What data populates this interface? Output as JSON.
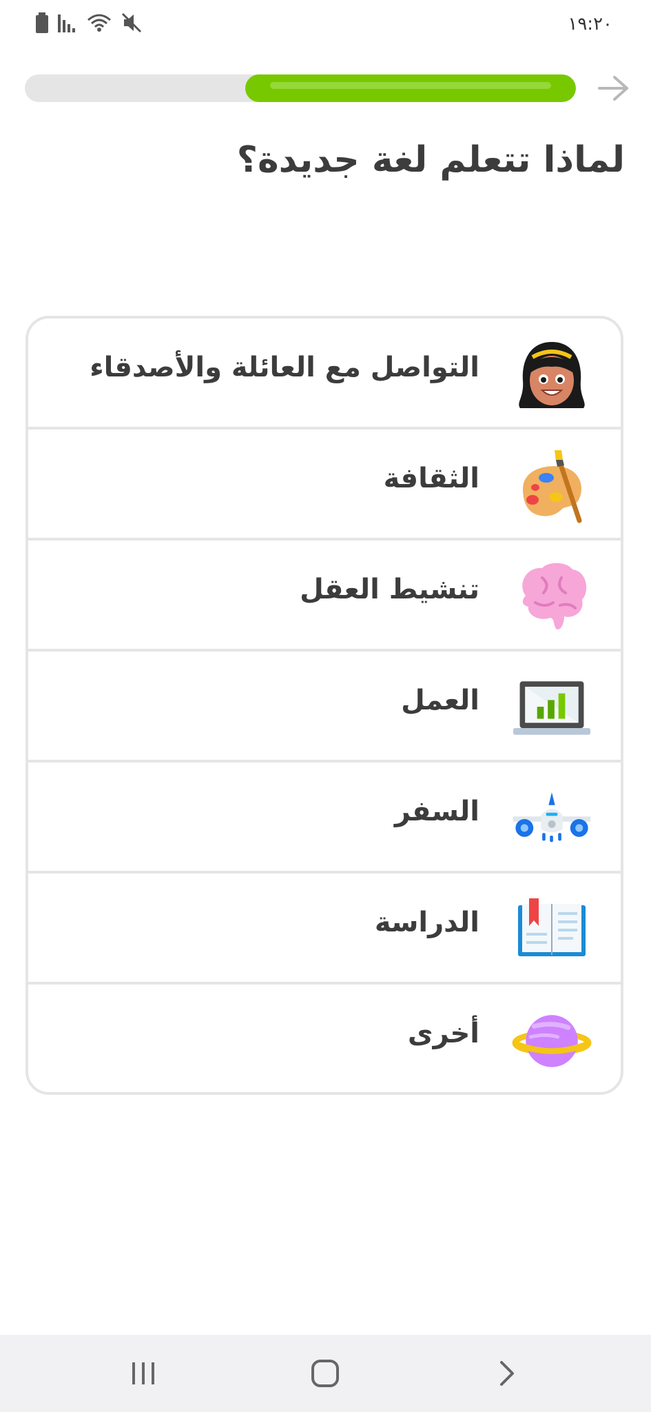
{
  "status_bar": {
    "time": "١٩:٢٠",
    "icons": [
      "battery-icon",
      "signal-icon",
      "wifi-icon",
      "mute-icon"
    ]
  },
  "progress": {
    "value_percent": 60,
    "color": "#78c800",
    "track_color": "#e5e5e5"
  },
  "title": "لماذا تتعلم لغة جديدة؟",
  "options": [
    {
      "label": "التواصل مع العائلة والأصدقاء",
      "icon": "person-icon"
    },
    {
      "label": "الثقافة",
      "icon": "palette-icon"
    },
    {
      "label": "تنشيط العقل",
      "icon": "brain-icon"
    },
    {
      "label": "العمل",
      "icon": "laptop-chart-icon"
    },
    {
      "label": "السفر",
      "icon": "airplane-icon"
    },
    {
      "label": "الدراسة",
      "icon": "book-icon"
    },
    {
      "label": "أخرى",
      "icon": "planet-icon"
    }
  ],
  "nav": {
    "buttons": [
      "recents-icon",
      "home-icon",
      "back-icon"
    ]
  }
}
